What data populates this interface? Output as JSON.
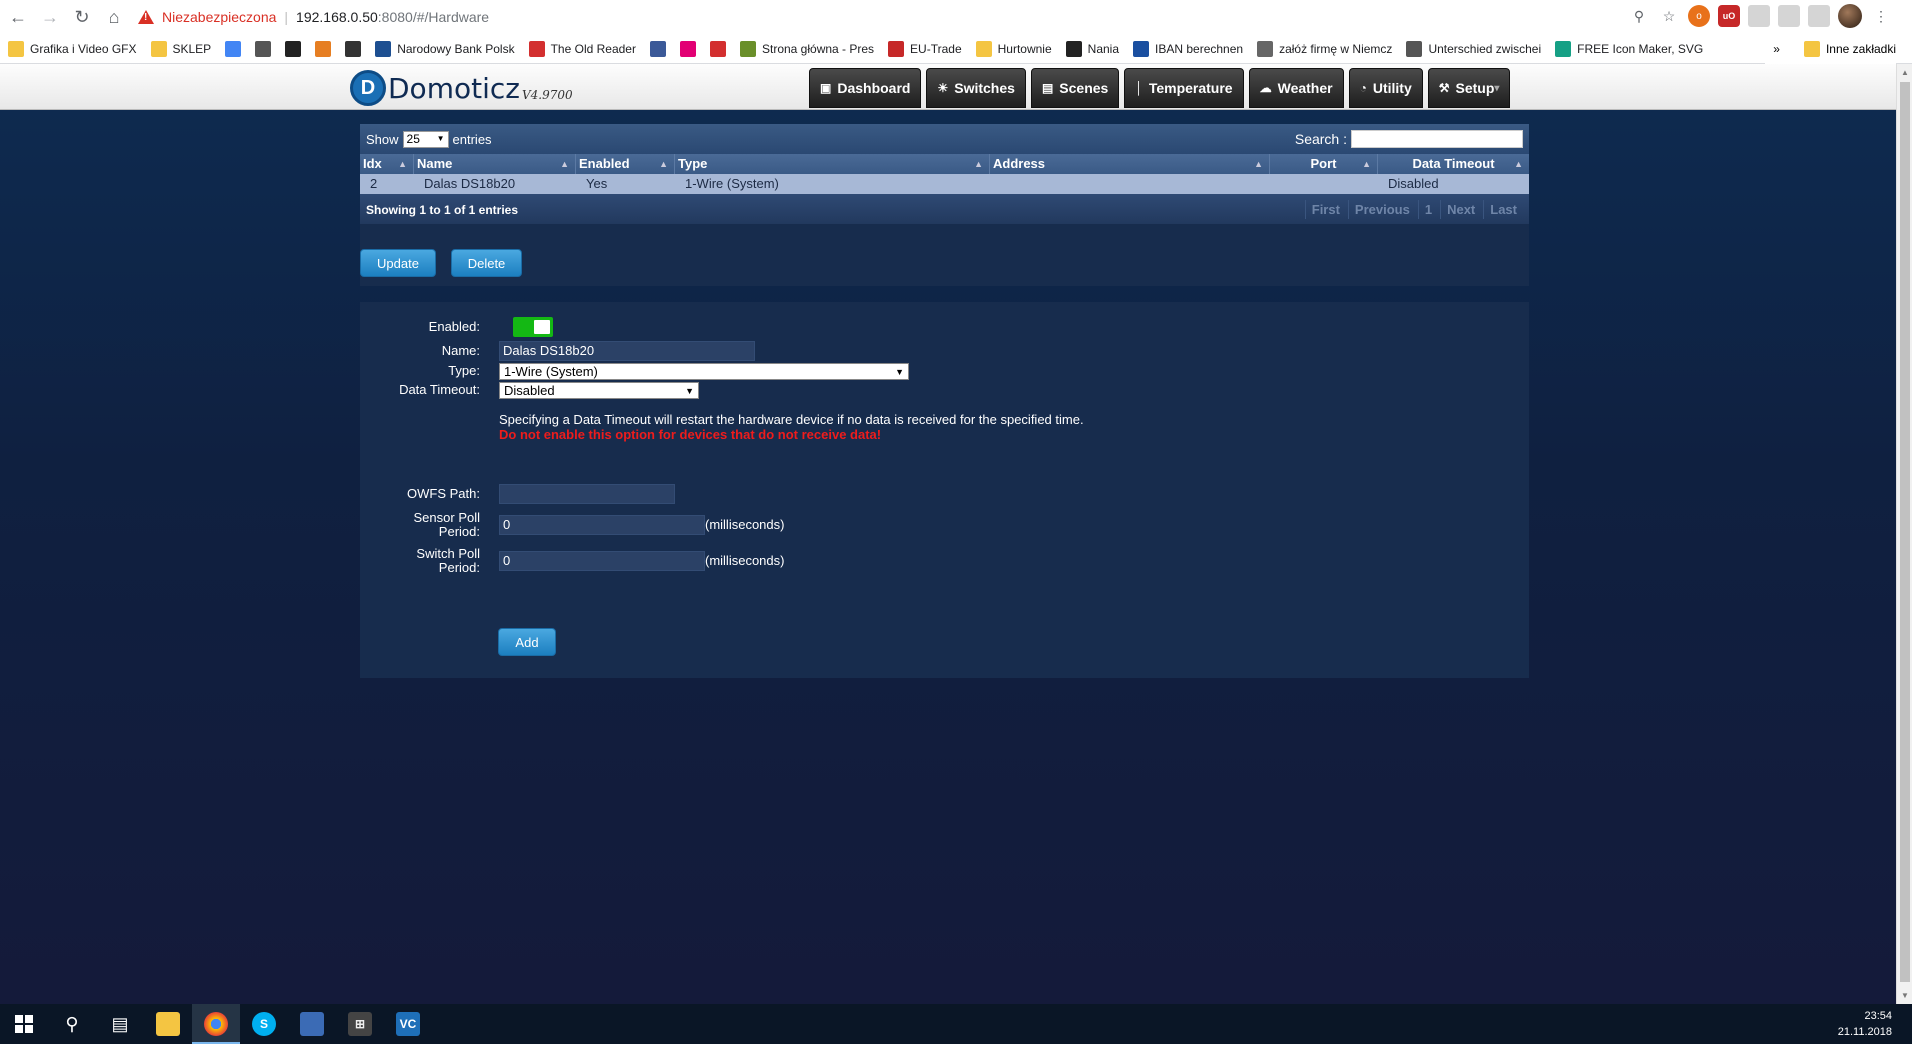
{
  "browser": {
    "security_label": "Niezabezpieczona",
    "url_host": "192.168.0.50",
    "url_rest": ":8080/#/Hardware",
    "bookmarks": [
      {
        "label": "Grafika i Video GFX",
        "icon": "folder-icon"
      },
      {
        "label": "SKLEP",
        "icon": "folder-icon"
      },
      {
        "label": "",
        "icon": "docs-icon"
      },
      {
        "label": "",
        "icon": "speedtest-icon"
      },
      {
        "label": "",
        "icon": "dn-icon"
      },
      {
        "label": "",
        "icon": "pinwheel-icon"
      },
      {
        "label": "",
        "icon": "square-icon"
      },
      {
        "label": "Narodowy Bank Polsk",
        "icon": "nbp-icon"
      },
      {
        "label": "The Old Reader",
        "icon": "oldreader-icon"
      },
      {
        "label": "",
        "icon": "facebook-icon"
      },
      {
        "label": "",
        "icon": "tmobile-icon"
      },
      {
        "label": "",
        "icon": "bank-icon"
      },
      {
        "label": "Strona główna - Pres",
        "icon": "strona-icon"
      },
      {
        "label": "EU-Trade",
        "icon": "eutrade-icon"
      },
      {
        "label": "Hurtownie",
        "icon": "folder-icon"
      },
      {
        "label": "Nania",
        "icon": "nania-icon"
      },
      {
        "label": "IBAN berechnen",
        "icon": "iban-icon"
      },
      {
        "label": "załóż firmę w Niemcz",
        "icon": "bird-icon"
      },
      {
        "label": "Unterschied zwischei",
        "icon": "ft-icon"
      },
      {
        "label": "FREE Icon Maker, SVG",
        "icon": "iconmaker-icon"
      }
    ],
    "more_label": "»",
    "other_bookmarks": "Inne zakładki"
  },
  "app": {
    "logo": "Domoticz",
    "version": "V4.9700",
    "nav": [
      {
        "label": "Dashboard",
        "icon": "monitor-icon"
      },
      {
        "label": "Switches",
        "icon": "bulb-icon"
      },
      {
        "label": "Scenes",
        "icon": "film-icon"
      },
      {
        "label": "Temperature",
        "icon": "thermometer-icon"
      },
      {
        "label": "Weather",
        "icon": "cloud-icon"
      },
      {
        "label": "Utility",
        "icon": "gauge-icon"
      },
      {
        "label": "Setup",
        "icon": "tools-icon"
      }
    ]
  },
  "table": {
    "show_label": "Show",
    "show_value": "25",
    "entries_label": "entries",
    "search_label": "Search :",
    "columns": [
      "Idx",
      "Name",
      "Enabled",
      "Type",
      "Address",
      "Port",
      "Data Timeout"
    ],
    "rows": [
      {
        "idx": "2",
        "name": "Dalas DS18b20",
        "enabled": "Yes",
        "type": "1-Wire (System)",
        "address": "",
        "port": "",
        "timeout": "Disabled"
      }
    ],
    "showing": "Showing 1 to 1 of 1 entries",
    "pager": [
      "First",
      "Previous",
      "1",
      "Next",
      "Last"
    ]
  },
  "buttons": {
    "update": "Update",
    "delete": "Delete",
    "add": "Add"
  },
  "form": {
    "enabled_label": "Enabled:",
    "enabled_value": true,
    "name_label": "Name:",
    "name_value": "Dalas DS18b20",
    "type_label": "Type:",
    "type_value": "1-Wire (System)",
    "timeout_label": "Data Timeout:",
    "timeout_value": "Disabled",
    "timeout_help": "Specifying a Data Timeout will restart the hardware device if no data is received for the specified time.",
    "timeout_warning": "Do not enable this option for devices that do not receive data!",
    "owfs_label": "OWFS Path:",
    "owfs_value": "",
    "sensor_label_1": "Sensor Poll",
    "sensor_label_2": "Period:",
    "sensor_value": "0",
    "switch_label_1": "Switch Poll",
    "switch_label_2": "Period:",
    "switch_value": "0",
    "unit": "(milliseconds)"
  },
  "taskbar": {
    "time": "23:54",
    "date": "21.11.2018"
  },
  "colors": {
    "accent": "#1c7fc0",
    "toggle_on": "#14b814",
    "warning": "#ee1c1c"
  }
}
